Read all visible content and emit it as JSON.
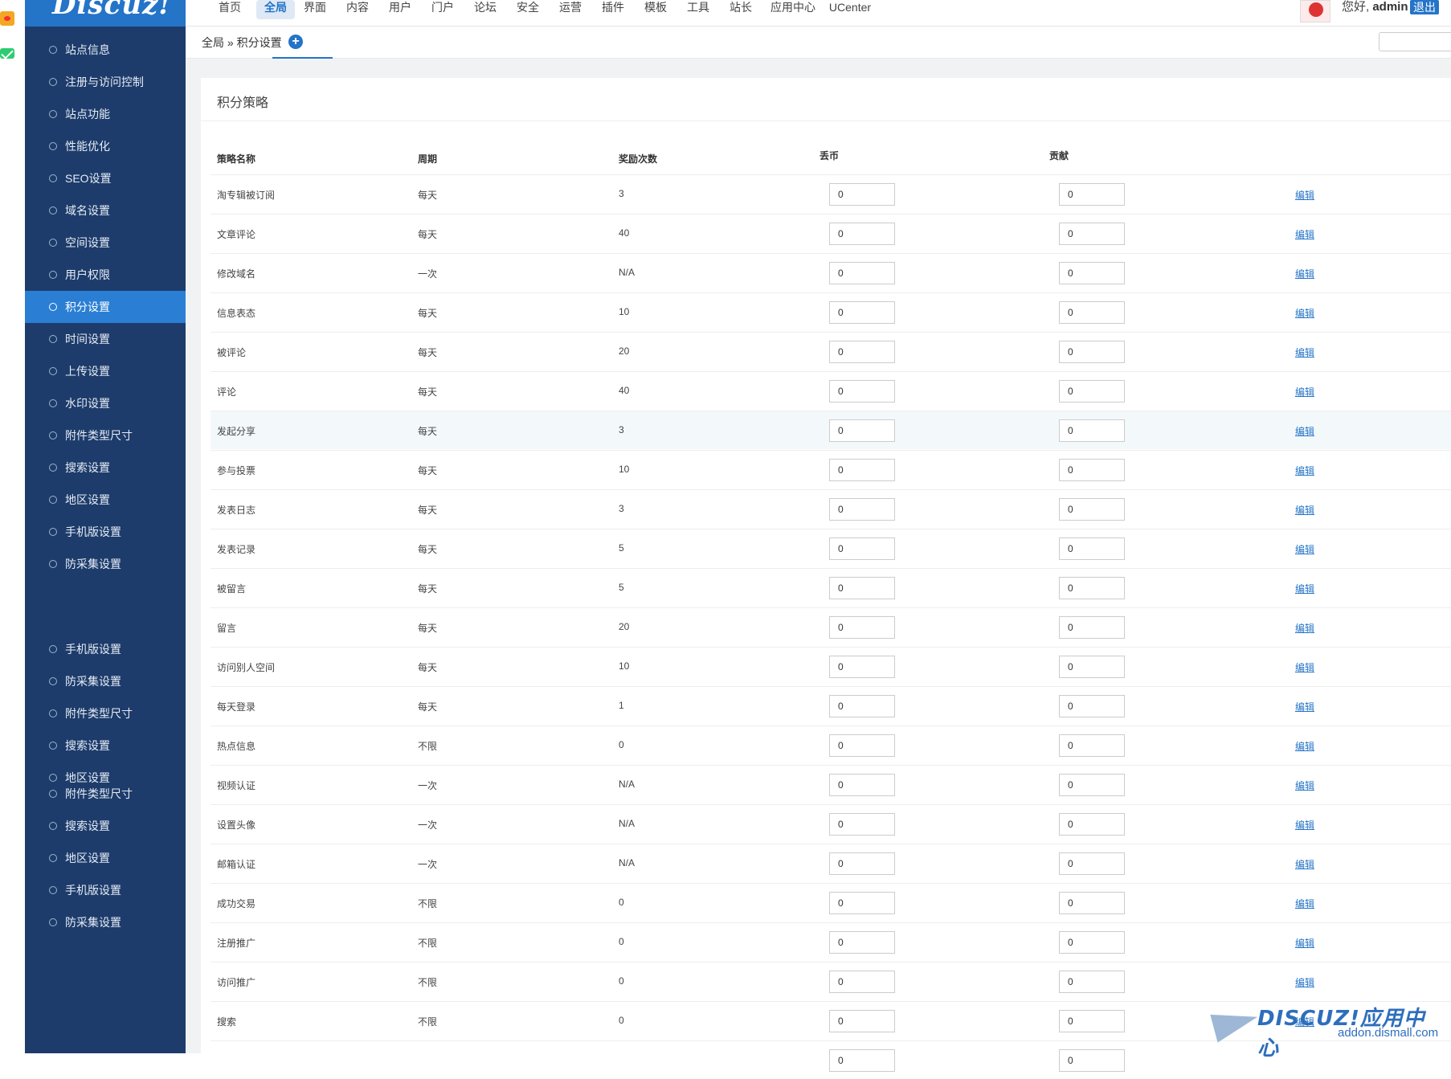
{
  "brand": {
    "logo_text": "Discuz!"
  },
  "topnav": {
    "items": [
      "首页",
      "全局",
      "界面",
      "内容",
      "用户",
      "门户",
      "论坛",
      "安全",
      "运营",
      "插件",
      "模板",
      "工具",
      "站长",
      "应用中心",
      "UCenter"
    ],
    "active": "全局",
    "greeting_prefix": "您好, ",
    "username": "admin",
    "logout_label": "退出"
  },
  "breadcrumb": {
    "text": "全局 » 积分设置",
    "add_icon": "+"
  },
  "sidebar": {
    "items": [
      "站点信息",
      "注册与访问控制",
      "站点功能",
      "性能优化",
      "SEO设置",
      "域名设置",
      "空间设置",
      "用户权限",
      "积分设置",
      "时间设置",
      "上传设置",
      "水印设置",
      "附件类型尺寸",
      "搜索设置",
      "地区设置",
      "手机版设置",
      "防采集设置"
    ],
    "active_index": 8,
    "ghost_items": [
      "手机版设置",
      "防采集设置",
      "附件类型尺寸",
      "搜索设置",
      "地区设置",
      "附件类型尺寸",
      "搜索设置",
      "地区设置",
      "手机版设置",
      "防采集设置"
    ]
  },
  "panel": {
    "title": "积分策略",
    "headers": {
      "name": "策略名称",
      "cycle": "周期",
      "count": "奖励次数",
      "coin": "丢币",
      "contrib": "贡献"
    },
    "edit_label": "编辑",
    "rows": [
      {
        "name": "淘专辑被订阅",
        "cycle": "每天",
        "count": "3",
        "coin": "0",
        "contrib": "0"
      },
      {
        "name": "文章评论",
        "cycle": "每天",
        "count": "40",
        "coin": "0",
        "contrib": "0"
      },
      {
        "name": "修改域名",
        "cycle": "一次",
        "count": "N/A",
        "coin": "0",
        "contrib": "0"
      },
      {
        "name": "信息表态",
        "cycle": "每天",
        "count": "10",
        "coin": "0",
        "contrib": "0"
      },
      {
        "name": "被评论",
        "cycle": "每天",
        "count": "20",
        "coin": "0",
        "contrib": "0"
      },
      {
        "name": "评论",
        "cycle": "每天",
        "count": "40",
        "coin": "0",
        "contrib": "0"
      },
      {
        "name": "发起分享",
        "cycle": "每天",
        "count": "3",
        "coin": "0",
        "contrib": "0"
      },
      {
        "name": "参与投票",
        "cycle": "每天",
        "count": "10",
        "coin": "0",
        "contrib": "0"
      },
      {
        "name": "发表日志",
        "cycle": "每天",
        "count": "3",
        "coin": "0",
        "contrib": "0"
      },
      {
        "name": "发表记录",
        "cycle": "每天",
        "count": "5",
        "coin": "0",
        "contrib": "0"
      },
      {
        "name": "被留言",
        "cycle": "每天",
        "count": "5",
        "coin": "0",
        "contrib": "0"
      },
      {
        "name": "留言",
        "cycle": "每天",
        "count": "20",
        "coin": "0",
        "contrib": "0"
      },
      {
        "name": "访问别人空间",
        "cycle": "每天",
        "count": "10",
        "coin": "0",
        "contrib": "0"
      },
      {
        "name": "每天登录",
        "cycle": "每天",
        "count": "1",
        "coin": "0",
        "contrib": "0"
      },
      {
        "name": "热点信息",
        "cycle": "不限",
        "count": "0",
        "coin": "0",
        "contrib": "0"
      },
      {
        "name": "视频认证",
        "cycle": "一次",
        "count": "N/A",
        "coin": "0",
        "contrib": "0"
      },
      {
        "name": "设置头像",
        "cycle": "一次",
        "count": "N/A",
        "coin": "0",
        "contrib": "0"
      },
      {
        "name": "邮箱认证",
        "cycle": "一次",
        "count": "N/A",
        "coin": "0",
        "contrib": "0"
      },
      {
        "name": "成功交易",
        "cycle": "不限",
        "count": "0",
        "coin": "0",
        "contrib": "0"
      },
      {
        "name": "注册推广",
        "cycle": "不限",
        "count": "0",
        "coin": "0",
        "contrib": "0"
      },
      {
        "name": "访问推广",
        "cycle": "不限",
        "count": "0",
        "coin": "0",
        "contrib": "0"
      },
      {
        "name": "搜索",
        "cycle": "不限",
        "count": "0",
        "coin": "0",
        "contrib": "0"
      },
      {
        "name": "",
        "cycle": "",
        "count": "",
        "coin": "0",
        "contrib": "0"
      }
    ],
    "highlight_row": 6
  },
  "watermark": {
    "main": "DISCUZ!应用中心",
    "sub": "addon.dismall.com"
  },
  "colors": {
    "sidebar_bg": "#1d3c6b",
    "accent": "#2474c8",
    "active_item": "#2a7fd4"
  }
}
